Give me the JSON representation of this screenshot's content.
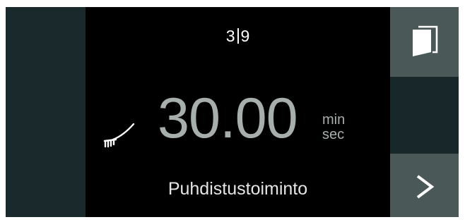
{
  "display": {
    "step": "3",
    "step_total": "9",
    "time_value": "30.00",
    "unit_min": "min",
    "unit_sec": "sec",
    "program_name": "Puhdistustoiminto"
  },
  "icons": {
    "program": "brush-icon",
    "door": "door-icon",
    "next": "play-arrow-icon"
  },
  "colors": {
    "screen_bg": "#000000",
    "panel_bg": "#1a2a2c",
    "button_bg": "#4a5857",
    "time_text": "#a7afac",
    "text": "#ffffff"
  }
}
